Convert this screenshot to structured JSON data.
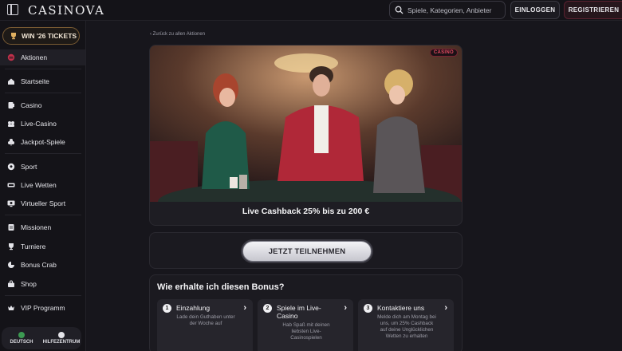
{
  "header": {
    "logo": "CASINOVA",
    "search_placeholder": "Spiele, Kategorien, Anbieter",
    "login_label": "EINLOGGEN",
    "register_label": "REGISTRIEREN"
  },
  "sidebar": {
    "tickets_label": "WIN '26 TICKETS",
    "items": [
      {
        "label": "Aktionen",
        "icon": "promotions-icon"
      },
      {
        "label": "Startseite",
        "icon": "home-icon"
      },
      {
        "label": "Casino",
        "icon": "casino-icon"
      },
      {
        "label": "Live-Casino",
        "icon": "live-casino-icon"
      },
      {
        "label": "Jackpot-Spiele",
        "icon": "jackpot-icon"
      },
      {
        "label": "Sport",
        "icon": "soccer-ball-icon"
      },
      {
        "label": "Live Wetten",
        "icon": "live-bets-icon"
      },
      {
        "label": "Virtueller Sport",
        "icon": "virtual-sport-icon"
      },
      {
        "label": "Missionen",
        "icon": "missions-icon"
      },
      {
        "label": "Turniere",
        "icon": "trophy-icon"
      },
      {
        "label": "Bonus Crab",
        "icon": "crab-icon"
      },
      {
        "label": "Shop",
        "icon": "shop-icon"
      },
      {
        "label": "VIP Programm",
        "icon": "vip-icon"
      }
    ],
    "footer": {
      "language_label": "DEUTSCH",
      "help_label": "HILFEZENTRUM"
    }
  },
  "main": {
    "back_link": "Zurück zu allen Aktionen",
    "badge": "CASINO",
    "promo_title": "Live Cashback 25% bis zu 200 €",
    "cta_label": "JETZT TEILNEHMEN",
    "how_title": "Wie erhalte ich diesen Bonus?",
    "steps": [
      {
        "num": "1",
        "title": "Einzahlung",
        "desc": "Lade dein Guthaben unter der Woche auf"
      },
      {
        "num": "2",
        "title": "Spiele im Live-Casino",
        "desc": "Hab Spaß mit deinen liebsten Live-Casinospielen"
      },
      {
        "num": "3",
        "title": "Kontaktiere uns",
        "desc": "Melde dich am Montag bei uns, um 25% Cashback auf deine Unglücklichen Wetten zu erhalten"
      }
    ]
  },
  "colors": {
    "accent_red": "#e64a62",
    "background": "#17161c",
    "gold": "#7a5b33"
  }
}
